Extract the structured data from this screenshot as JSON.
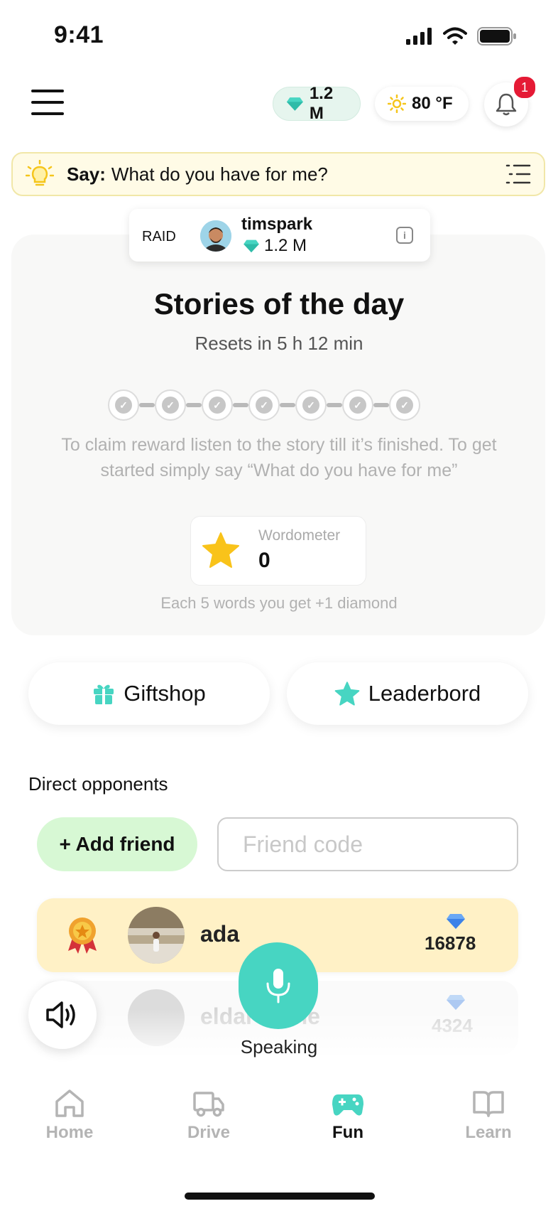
{
  "status": {
    "time": "9:41"
  },
  "header": {
    "diamonds": "1.2 M",
    "weather": "80 °F",
    "notifications": "1",
    "colors": {
      "diamond": "#47D5C2",
      "sun": "#F5C51B",
      "badge": "#E51A35"
    }
  },
  "say": {
    "label": "Say:",
    "text": "What do you have for me?"
  },
  "raid": {
    "label": "RAID",
    "user": "timspark",
    "diamonds": "1.2 M"
  },
  "stories": {
    "title": "Stories of the day",
    "resets": "Resets in 5 h 12 min",
    "steps_total": 7,
    "hint": "To claim reward listen to the story till it’s finished. To get started simply say “What do you have for me”",
    "wordometer_label": "Wordometer",
    "wordometer_value": "0",
    "each": "Each 5 words you get +1 diamond"
  },
  "buttons": {
    "giftshop": "Giftshop",
    "leaderboard": "Leaderbord"
  },
  "opponents": {
    "title": "Direct opponents",
    "add_friend": "+ Add friend",
    "friend_code_placeholder": "Friend code",
    "rows": [
      {
        "name": "ada",
        "score": "16878"
      },
      {
        "name": "eldar mane",
        "score": "4324"
      }
    ]
  },
  "voice": {
    "speaking": "Speaking"
  },
  "tabs": [
    {
      "label": "Home"
    },
    {
      "label": "Drive"
    },
    {
      "label": "Fun"
    },
    {
      "label": "Learn"
    }
  ]
}
